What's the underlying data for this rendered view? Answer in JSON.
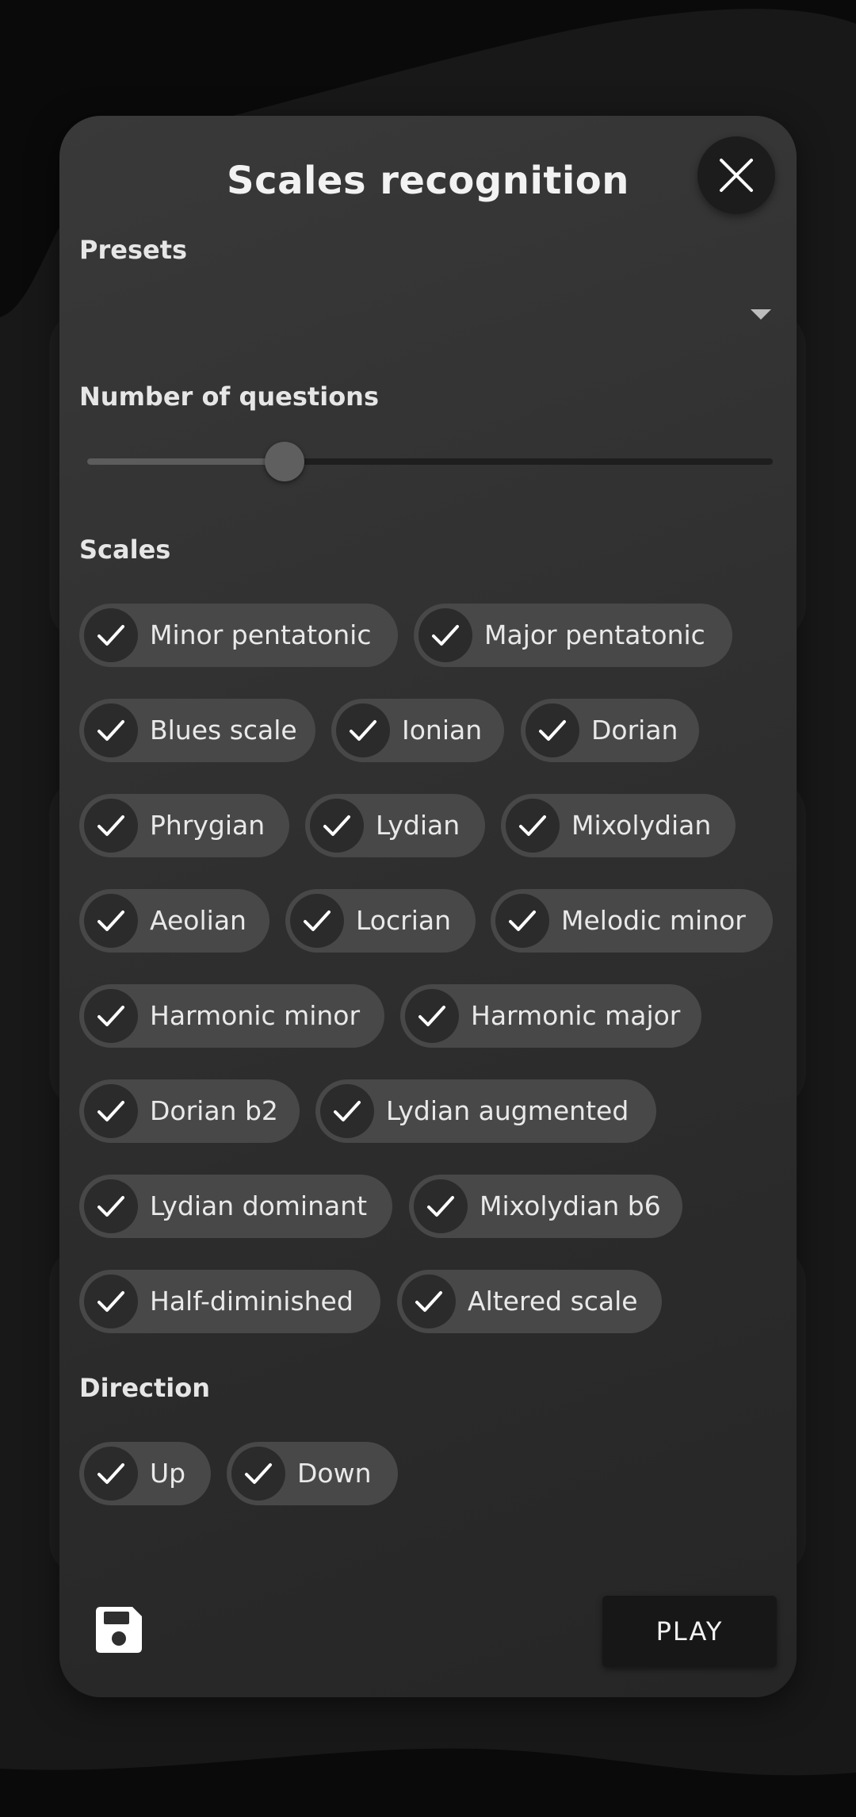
{
  "dialog": {
    "title": "Scales recognition",
    "close_icon": "close-icon"
  },
  "presets": {
    "label": "Presets",
    "selected_value": ""
  },
  "questions": {
    "label": "Number of questions",
    "slider_fraction": 0.288
  },
  "scales": {
    "label": "Scales",
    "items": [
      {
        "label": "Minor pentatonic",
        "checked": true
      },
      {
        "label": "Major pentatonic",
        "checked": true
      },
      {
        "label": "Blues scale",
        "checked": true
      },
      {
        "label": "Ionian",
        "checked": true
      },
      {
        "label": "Dorian",
        "checked": true
      },
      {
        "label": "Phrygian",
        "checked": true
      },
      {
        "label": "Lydian",
        "checked": true
      },
      {
        "label": "Mixolydian",
        "checked": true
      },
      {
        "label": "Aeolian",
        "checked": true
      },
      {
        "label": "Locrian",
        "checked": true
      },
      {
        "label": "Melodic minor",
        "checked": true
      },
      {
        "label": "Harmonic minor",
        "checked": true
      },
      {
        "label": "Harmonic major",
        "checked": true
      },
      {
        "label": "Dorian b2",
        "checked": true
      },
      {
        "label": "Lydian augmented",
        "checked": true
      },
      {
        "label": "Lydian dominant",
        "checked": true
      },
      {
        "label": "Mixolydian b6",
        "checked": true
      },
      {
        "label": "Half-diminished",
        "checked": true
      },
      {
        "label": "Altered scale",
        "checked": true
      }
    ]
  },
  "direction": {
    "label": "Direction",
    "items": [
      {
        "label": "Up",
        "checked": true
      },
      {
        "label": "Down",
        "checked": true
      }
    ]
  },
  "footer": {
    "save_icon": "floppy-disk-icon",
    "play_label": "PLAY"
  },
  "colors": {
    "background": "#0d0d0d",
    "dialog": "#333333",
    "chip": "#484848",
    "chip_check": "#2b2b2b",
    "play_button": "#171717"
  }
}
